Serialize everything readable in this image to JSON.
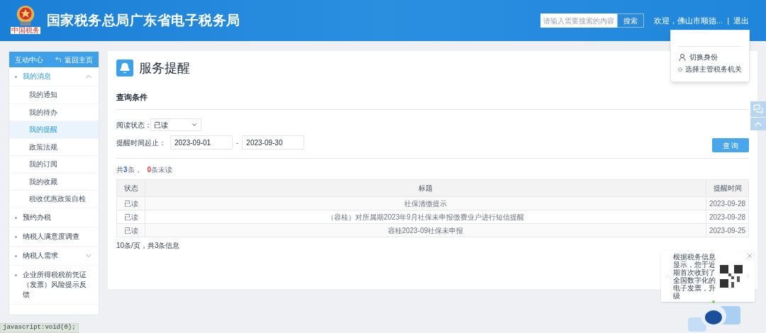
{
  "header": {
    "site_title": "国家税务总局广东省电子税务局",
    "emblem_caption": "中国税务",
    "search": {
      "placeholder": "请输入需要搜索的内容",
      "button": "搜索"
    },
    "welcome": "欢迎，佛山市顺德...",
    "separator": "|",
    "logout": "退出"
  },
  "user_menu": {
    "items": [
      {
        "kind": "switch",
        "label": "切换身份"
      },
      {
        "kind": "office",
        "label": "选择主管税务机关"
      }
    ]
  },
  "sidebar": {
    "title": "互动中心",
    "back": "返回主页",
    "items": [
      {
        "kind": "group",
        "label": "我的消息",
        "expanded": true,
        "children": [
          {
            "label": "我的通知",
            "selected": false
          },
          {
            "label": "我的待办",
            "selected": false
          },
          {
            "label": "我的提醒",
            "selected": true
          },
          {
            "label": "政策法规",
            "selected": false
          },
          {
            "label": "我的订阅",
            "selected": false
          },
          {
            "label": "我的收藏",
            "selected": false
          },
          {
            "label": "税收优惠政策自检",
            "selected": false
          }
        ]
      },
      {
        "kind": "link",
        "label": "预约办税"
      },
      {
        "kind": "link",
        "label": "纳税人满意度调查"
      },
      {
        "kind": "group",
        "label": "纳税人需求",
        "expanded": false
      },
      {
        "kind": "link",
        "label": "企业所得税税前凭证（发票）风险提示反馈"
      }
    ]
  },
  "page": {
    "title": "服务提醒",
    "section": "查询条件",
    "filters": {
      "status_label": "阅读状态：",
      "status_value": "已读",
      "date_label": "提醒时间起止：",
      "date_from": "2023-09-01",
      "date_dash": "-",
      "date_to": "2023-09-30",
      "query_button": "查 询"
    },
    "summary": {
      "total_prefix": "共",
      "total": "3",
      "total_suffix": "条，",
      "unread": "0",
      "unread_suffix": "条未读"
    },
    "table": {
      "columns": [
        "状态",
        "标题",
        "提醒时间"
      ],
      "rows": [
        [
          "已读",
          "社保清缴提示",
          "2023-09-28"
        ],
        [
          "已读",
          "（容桂）对所属期2023年9月社保未申报缴费业户进行短信提醒",
          "2023-09-28"
        ],
        [
          "已读",
          "容桂2023-09社保未申报",
          "2023-09-25"
        ]
      ]
    },
    "pagination": "10条/页，共3条信息"
  },
  "notice": {
    "text": "根据税务信息显示，您于近期首次收到了全国数字化的电子发票，升级"
  },
  "status_bar": "javascript:void(0);"
}
